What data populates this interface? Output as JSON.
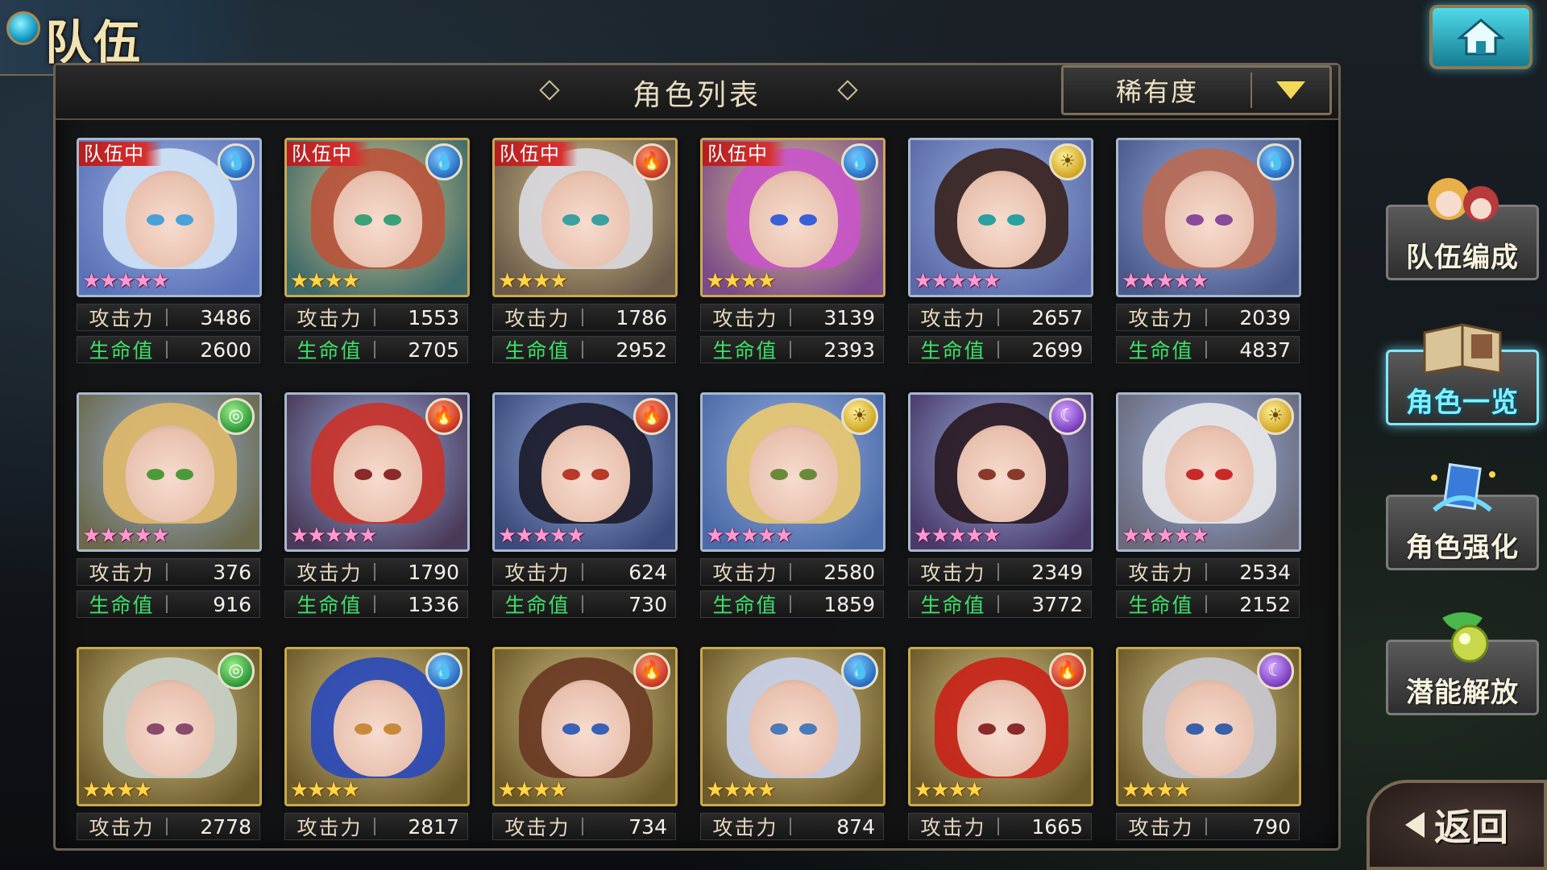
{
  "header": {
    "title": "队伍",
    "list_title": "角色列表",
    "sort_label": "稀有度"
  },
  "labels": {
    "attack": "攻击力",
    "hp": "生命值",
    "in_team": "队伍中"
  },
  "side_menu": [
    {
      "label": "队伍编成",
      "active": false
    },
    {
      "label": "角色一览",
      "active": true
    },
    {
      "label": "角色强化",
      "active": false
    },
    {
      "label": "潜能解放",
      "active": false
    }
  ],
  "back_label": "返回",
  "characters": [
    {
      "in_team": true,
      "element": "water",
      "stars": 5,
      "frame": "silver",
      "attack": "3486",
      "hp": "2600",
      "hair": "#cfe3f6",
      "eye": "#4aa0d8",
      "bg": "#5a72b8"
    },
    {
      "in_team": true,
      "element": "water",
      "stars": 4,
      "frame": "gold",
      "attack": "1553",
      "hp": "2705",
      "hair": "#b9553c",
      "eye": "#3aa078",
      "bg": "#3d6a6a"
    },
    {
      "in_team": true,
      "element": "fire",
      "stars": 4,
      "frame": "gold",
      "attack": "1786",
      "hp": "2952",
      "hair": "#d9d9df",
      "eye": "#3aa0a0",
      "bg": "#6a5a4a"
    },
    {
      "in_team": true,
      "element": "water",
      "stars": 4,
      "frame": "gold",
      "attack": "3139",
      "hp": "2393",
      "hair": "#c855c8",
      "eye": "#3a60d8",
      "bg": "#7a4a8a"
    },
    {
      "in_team": false,
      "element": "light",
      "stars": 5,
      "frame": "silver",
      "attack": "2657",
      "hp": "2699",
      "hair": "#3a2420",
      "eye": "#2aa0a0",
      "bg": "#5a6aa8"
    },
    {
      "in_team": false,
      "element": "water",
      "stars": 5,
      "frame": "silver",
      "attack": "2039",
      "hp": "4837",
      "hair": "#b86a55",
      "eye": "#8a4a9a",
      "bg": "#4a5a8a"
    },
    {
      "in_team": false,
      "element": "wind",
      "stars": 5,
      "frame": "silver",
      "attack": "376",
      "hp": "916",
      "hair": "#e0b86a",
      "eye": "#4a9a3a",
      "bg": "#6a6a4a"
    },
    {
      "in_team": false,
      "element": "fire",
      "stars": 5,
      "frame": "silver",
      "attack": "1790",
      "hp": "1336",
      "hair": "#c8332a",
      "eye": "#8a2a2a",
      "bg": "#4a3a5a"
    },
    {
      "in_team": false,
      "element": "fire",
      "stars": 5,
      "frame": "silver",
      "attack": "624",
      "hp": "730",
      "hair": "#1c1c2a",
      "eye": "#b83a2a",
      "bg": "#3a4a7a"
    },
    {
      "in_team": false,
      "element": "light",
      "stars": 5,
      "frame": "silver",
      "attack": "2580",
      "hp": "1859",
      "hair": "#e8c870",
      "eye": "#6a8a3a",
      "bg": "#4a6aa8"
    },
    {
      "in_team": false,
      "element": "dark",
      "stars": 5,
      "frame": "silver",
      "attack": "2349",
      "hp": "3772",
      "hair": "#2a1a24",
      "eye": "#8a3a2a",
      "bg": "#4a3a6a"
    },
    {
      "in_team": false,
      "element": "light",
      "stars": 5,
      "frame": "silver",
      "attack": "2534",
      "hp": "2152",
      "hair": "#e8e8ea",
      "eye": "#c82a2a",
      "bg": "#6a6a7a"
    },
    {
      "in_team": false,
      "element": "wind",
      "stars": 4,
      "frame": "gold",
      "attack": "2778",
      "hp": "",
      "hair": "#c8d0c8",
      "eye": "#8a4a6a",
      "bg": "#6a5a2a"
    },
    {
      "in_team": false,
      "element": "water",
      "stars": 4,
      "frame": "gold",
      "attack": "2817",
      "hp": "",
      "hair": "#2a4ab8",
      "eye": "#c88a3a",
      "bg": "#6a5a2a"
    },
    {
      "in_team": false,
      "element": "fire",
      "stars": 4,
      "frame": "gold",
      "attack": "734",
      "hp": "",
      "hair": "#6a3a24",
      "eye": "#3a60b8",
      "bg": "#6a5a2a"
    },
    {
      "in_team": false,
      "element": "water",
      "stars": 4,
      "frame": "gold",
      "attack": "874",
      "hp": "",
      "hair": "#c8d0e8",
      "eye": "#4a7ab8",
      "bg": "#6a5a2a"
    },
    {
      "in_team": false,
      "element": "fire",
      "stars": 4,
      "frame": "gold",
      "attack": "1665",
      "hp": "",
      "hair": "#c8241a",
      "eye": "#8a2a2a",
      "bg": "#6a5a2a"
    },
    {
      "in_team": false,
      "element": "dark",
      "stars": 4,
      "frame": "gold",
      "attack": "790",
      "hp": "",
      "hair": "#c8c8d0",
      "eye": "#3a60a8",
      "bg": "#6a5a2a"
    }
  ],
  "colors": {
    "accent_cyan": "#7ff2ff",
    "hp_green": "#3ee06a",
    "team_red": "#d83030",
    "star_gold": "#ffd54a"
  }
}
